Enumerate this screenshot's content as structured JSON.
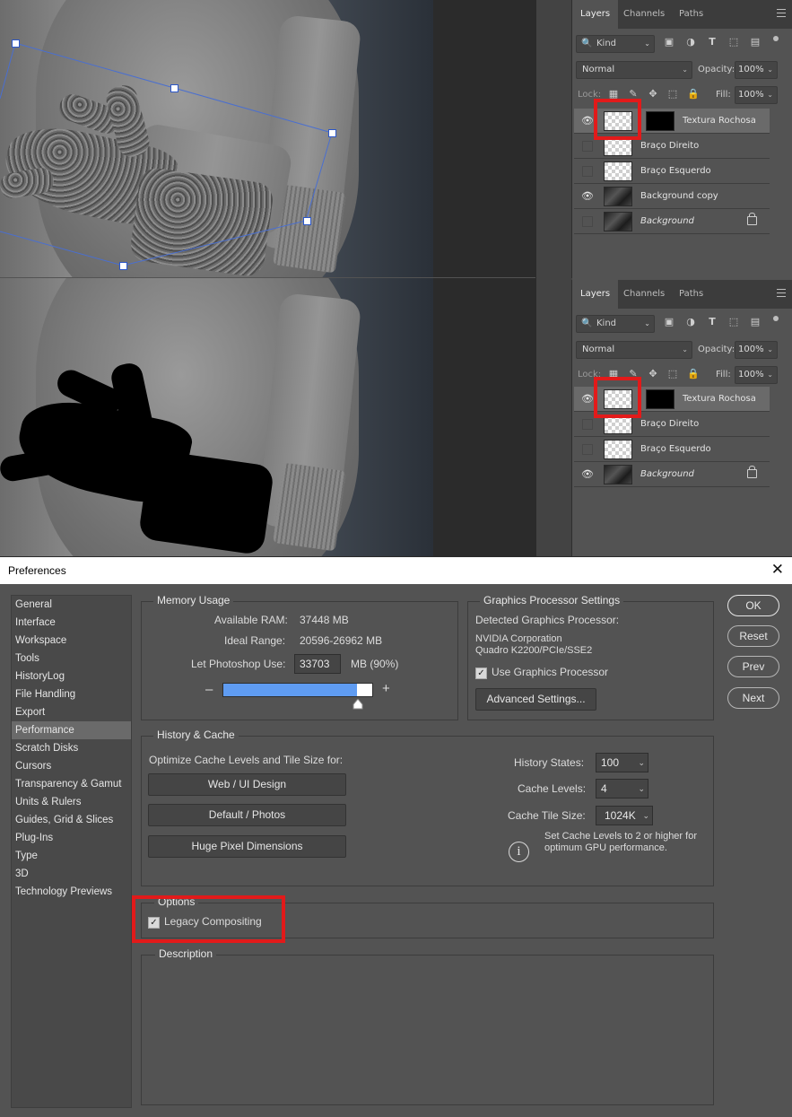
{
  "layers_panels": [
    {
      "tabs": [
        "Layers",
        "Channels",
        "Paths"
      ],
      "kind_label": "Kind",
      "blend_mode": "Normal",
      "opacity_label": "Opacity:",
      "opacity_value": "100%",
      "lock_label": "Lock:",
      "fill_label": "Fill:",
      "fill_value": "100%",
      "layers": [
        {
          "name": "Textura Rochosa",
          "visible": true,
          "selected": true,
          "has_mask": true
        },
        {
          "name": "Braço Direito",
          "visible": false
        },
        {
          "name": "Braço Esquerdo",
          "visible": false
        },
        {
          "name": "Background copy",
          "visible": true
        },
        {
          "name": "Background",
          "visible": false,
          "locked": true
        }
      ]
    },
    {
      "tabs": [
        "Layers",
        "Channels",
        "Paths"
      ],
      "kind_label": "Kind",
      "blend_mode": "Normal",
      "opacity_label": "Opacity:",
      "opacity_value": "100%",
      "lock_label": "Lock:",
      "fill_label": "Fill:",
      "fill_value": "100%",
      "layers": [
        {
          "name": "Textura Rochosa",
          "visible": true,
          "selected": true,
          "has_mask": true
        },
        {
          "name": "Braço Direito",
          "visible": false
        },
        {
          "name": "Braço Esquerdo",
          "visible": false
        },
        {
          "name": "Background",
          "visible": true,
          "locked": true
        }
      ]
    }
  ],
  "dialog": {
    "title": "Preferences",
    "nav": [
      "General",
      "Interface",
      "Workspace",
      "Tools",
      "HistoryLog",
      "File Handling",
      "Export",
      "Performance",
      "Scratch Disks",
      "Cursors",
      "Transparency & Gamut",
      "Units & Rulers",
      "Guides, Grid & Slices",
      "Plug-Ins",
      "Type",
      "3D",
      "Technology Previews"
    ],
    "nav_active": "Performance",
    "memory": {
      "title": "Memory Usage",
      "available_label": "Available RAM:",
      "available_value": "37448 MB",
      "ideal_label": "Ideal Range:",
      "ideal_value": "20596-26962 MB",
      "let_label": "Let Photoshop Use:",
      "let_value": "33703",
      "let_unit": "MB (90%)",
      "minus": "–",
      "plus": "+",
      "slider_fraction": 0.9
    },
    "gpu": {
      "title": "Graphics Processor Settings",
      "detected_label": "Detected Graphics Processor:",
      "vendor": "NVIDIA Corporation",
      "model": "Quadro K2200/PCIe/SSE2",
      "use_gpu_label": "Use Graphics Processor",
      "use_gpu_checked": true,
      "advanced_button": "Advanced Settings..."
    },
    "history_cache": {
      "title": "History & Cache",
      "optimize_label": "Optimize Cache Levels and Tile Size for:",
      "buttons": [
        "Web / UI Design",
        "Default / Photos",
        "Huge Pixel Dimensions"
      ],
      "history_states_label": "History States:",
      "history_states_value": "100",
      "cache_levels_label": "Cache Levels:",
      "cache_levels_value": "4",
      "tile_size_label": "Cache Tile Size:",
      "tile_size_value": "1024K",
      "info_text_1": "Set Cache Levels to 2 or higher for",
      "info_text_2": "optimum GPU performance."
    },
    "options": {
      "title": "Options",
      "legacy_label": "Legacy Compositing",
      "legacy_checked": true
    },
    "description": {
      "title": "Description"
    },
    "buttons": {
      "ok": "OK",
      "reset": "Reset",
      "prev": "Prev",
      "next": "Next"
    }
  },
  "colors": {
    "highlight_box": "#e21a1a",
    "slider_fill": "#5f9cf2",
    "transform_handle": "#2b56c8"
  }
}
